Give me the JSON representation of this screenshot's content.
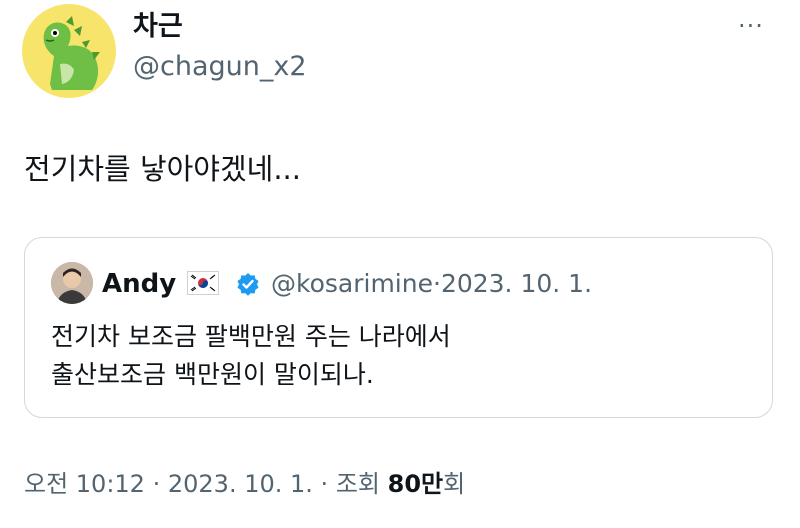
{
  "author": {
    "display_name": "차근",
    "handle": "@chagun_x2"
  },
  "more_glyph": "···",
  "tweet": {
    "text": "전기차를 낳아야겠네..."
  },
  "quoted": {
    "display_name": "Andy",
    "handle": "@kosarimine",
    "separator": "·",
    "date": "2023. 10. 1.",
    "flag_icon": "south-korea-flag-icon",
    "badge_icon": "verified-badge-icon",
    "badge_color": "#1d9bf0",
    "lines": [
      "전기차 보조금 팔백만원 주는 나라에서",
      "출산보조금 백만원이 말이되나."
    ]
  },
  "meta": {
    "time": "오전 10:12",
    "sep1": "·",
    "date": "2023. 10. 1.",
    "sep2": "·",
    "views_label": "조회",
    "views_value": "80만",
    "views_suffix": "회"
  },
  "colors": {
    "secondary_text": "#536471",
    "border": "#cfd9de",
    "avatar_bg": "#f7e46b",
    "dino_green": "#6fbe45"
  }
}
